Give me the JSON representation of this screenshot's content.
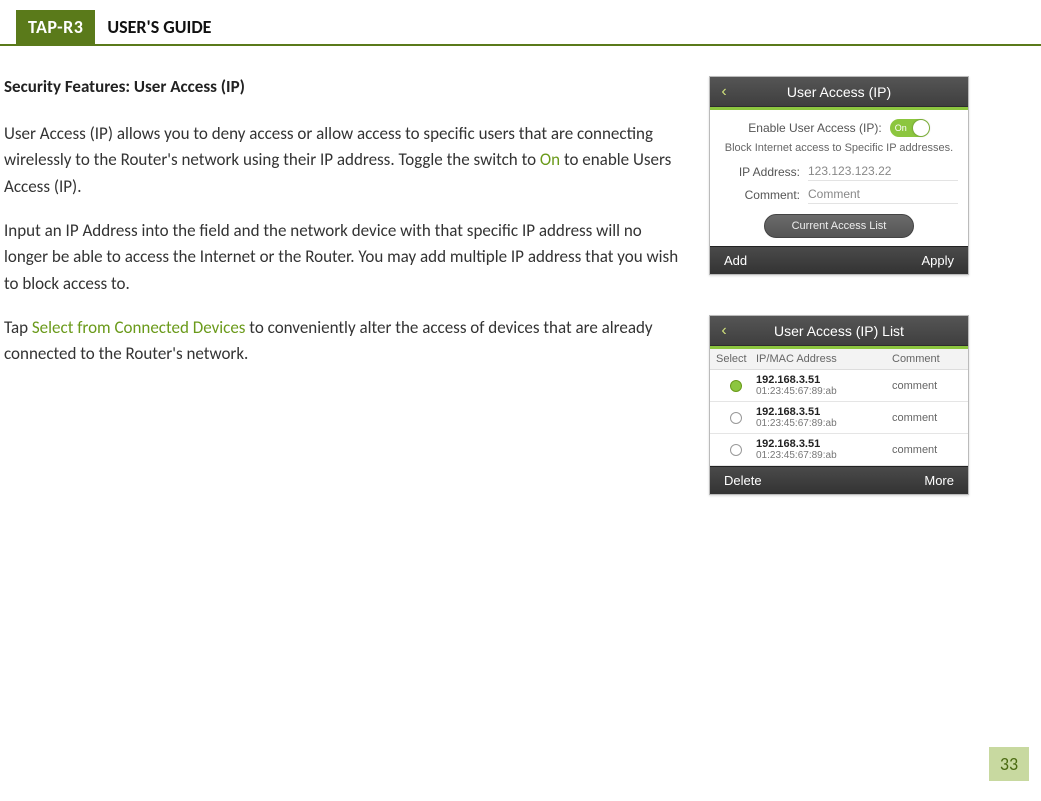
{
  "header": {
    "tag": "TAP-R3",
    "title": "USER'S GUIDE"
  },
  "section_title": "Security Features: User Access (IP)",
  "para1_a": "User Access (IP) allows you to deny access or allow access to specific users that are connecting wirelessly to the Router's network using their IP address.  Toggle the switch to ",
  "para1_on": "On",
  "para1_b": " to enable Users Access (IP).",
  "para2": "Input an IP Address into the field and the network device with that specific IP address will no longer be able to access the Internet or the Router.   You may add multiple IP address that you wish to block access to.",
  "para3_a": "Tap ",
  "para3_link": "Select from Connected Devices",
  "para3_b": " to conveniently alter the access of devices that are already connected to the Router's network.",
  "phone1": {
    "title": "User Access (IP)",
    "enable_label": "Enable User Access (IP):",
    "toggle_text": "On",
    "desc": "Block Internet access to Specific IP addresses.",
    "ip_label": "IP Address:",
    "ip_value": "123.123.123.22",
    "comment_label": "Comment:",
    "comment_value": "Comment",
    "current_btn": "Current Access List",
    "footer_left": "Add",
    "footer_right": "Apply"
  },
  "phone2": {
    "title": "User Access (IP) List",
    "col_select": "Select",
    "col_addr": "IP/MAC Address",
    "col_comment": "Comment",
    "rows": [
      {
        "selected": true,
        "ip": "192.168.3.51",
        "mac": "01:23:45:67:89:ab",
        "comment": "comment"
      },
      {
        "selected": false,
        "ip": "192.168.3.51",
        "mac": "01:23:45:67:89:ab",
        "comment": "comment"
      },
      {
        "selected": false,
        "ip": "192.168.3.51",
        "mac": "01:23:45:67:89:ab",
        "comment": "comment"
      }
    ],
    "footer_left": "Delete",
    "footer_right": "More"
  },
  "page_number": "33"
}
